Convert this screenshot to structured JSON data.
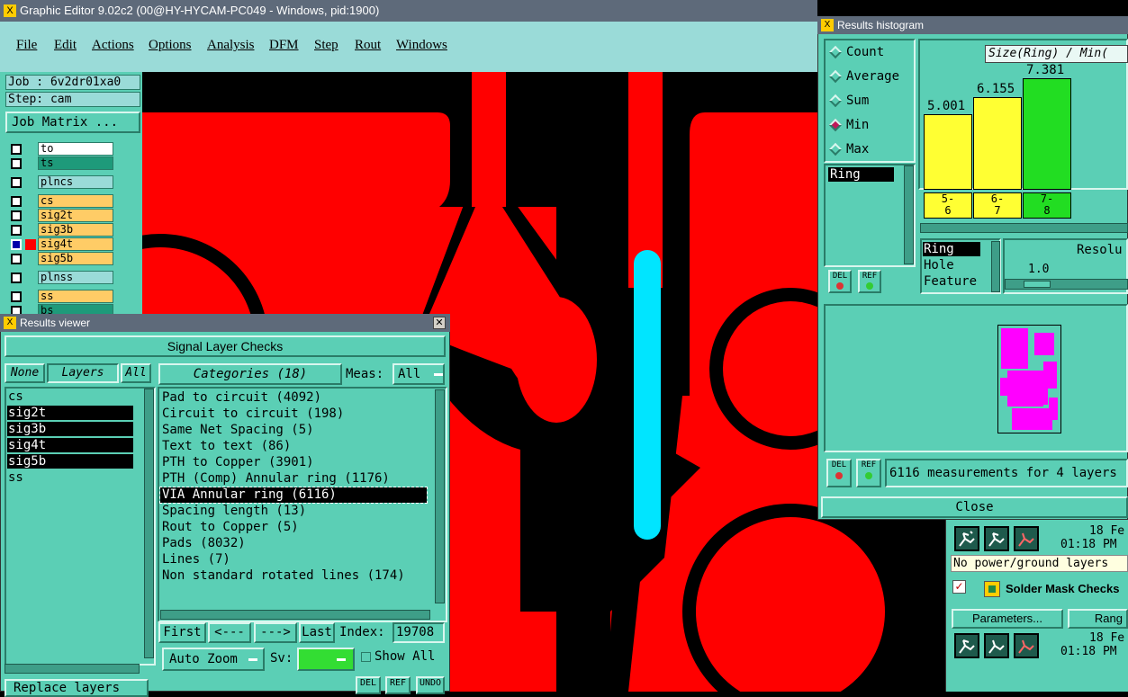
{
  "window": {
    "title": "Graphic Editor 9.02c2 (00@HY-HYCAM-PC049 - Windows, pid:1900)"
  },
  "menu": {
    "items": [
      "File",
      "Edit",
      "Actions",
      "Options",
      "Analysis",
      "DFM",
      "Step",
      "Rout",
      "Windows"
    ]
  },
  "job": {
    "job_label": "Job : 6v2dr01xa0",
    "step_label": "Step: cam",
    "matrix_button": "Job Matrix ..."
  },
  "layers_panel": [
    {
      "name": "to",
      "color": "#ffffff"
    },
    {
      "name": "ts",
      "color": "#1e9a7a"
    },
    {
      "name": "plncs",
      "color": "#9adbd8"
    },
    {
      "name": "cs",
      "color": "#ffcc66"
    },
    {
      "name": "sig2t",
      "color": "#ffcc66"
    },
    {
      "name": "sig3b",
      "color": "#ffcc66"
    },
    {
      "name": "sig4t",
      "color": "#ffcc66"
    },
    {
      "name": "sig5b",
      "color": "#ffcc66"
    },
    {
      "name": "plnss",
      "color": "#9adbd8"
    },
    {
      "name": "ss",
      "color": "#ffcc66"
    },
    {
      "name": "bs",
      "color": "#1e9a7a"
    }
  ],
  "results_viewer": {
    "title": "Results viewer",
    "header": "Signal Layer Checks",
    "none_label": "None",
    "layers_label": "Layers",
    "all_label": "All",
    "categories_label": "Categories (18)",
    "meas_label": "Meas:",
    "meas_value": "All",
    "layers": [
      {
        "name": "cs",
        "sel": false
      },
      {
        "name": "sig2t",
        "sel": true
      },
      {
        "name": "sig3b",
        "sel": true
      },
      {
        "name": "sig4t",
        "sel": true
      },
      {
        "name": "sig5b",
        "sel": true
      },
      {
        "name": "ss",
        "sel": false
      }
    ],
    "categories": [
      {
        "text": "Pad to circuit (4092)",
        "sel": false
      },
      {
        "text": "Circuit to circuit (198)",
        "sel": false
      },
      {
        "text": "Same Net Spacing (5)",
        "sel": false
      },
      {
        "text": "Text to text (86)",
        "sel": false
      },
      {
        "text": "PTH to Copper (3901)",
        "sel": false
      },
      {
        "text": "PTH (Comp) Annular ring (1176)",
        "sel": false
      },
      {
        "text": "VIA Annular ring (6116)",
        "sel": true
      },
      {
        "text": "Spacing length (13)",
        "sel": false
      },
      {
        "text": "Rout to Copper (5)",
        "sel": false
      },
      {
        "text": "Pads (8032)",
        "sel": false
      },
      {
        "text": "Lines (7)",
        "sel": false
      },
      {
        "text": "Non standard rotated lines (174)",
        "sel": false
      }
    ],
    "first": "First",
    "prev": "<---",
    "next": "--->",
    "last": "Last",
    "index_label": "Index:",
    "index_value": "19708",
    "auto_zoom": "Auto Zoom",
    "sv_label": "Sv:",
    "show_all": "Show All",
    "replace_layers": "Replace layers",
    "del": "DEL",
    "ref": "REF",
    "undo": "UNDO"
  },
  "histogram": {
    "title": "Results histogram",
    "modes": [
      {
        "label": "Count",
        "sel": false
      },
      {
        "label": "Average",
        "sel": false
      },
      {
        "label": "Sum",
        "sel": false
      },
      {
        "label": "Min",
        "sel": true
      },
      {
        "label": "Max",
        "sel": false
      }
    ],
    "chart_title": "Size(Ring) / Min(",
    "bars": [
      {
        "value": "5.001",
        "range": "5-\n6",
        "color": "#ffff33"
      },
      {
        "value": "6.155",
        "range": "6-\n7",
        "color": "#ffff33"
      },
      {
        "value": "7.381",
        "range": "7-\n8",
        "color": "#22dd22"
      }
    ],
    "attr_list": [
      "Ring"
    ],
    "types": [
      {
        "label": "Ring",
        "sel": true
      },
      {
        "label": "Hole",
        "sel": false
      },
      {
        "label": "Feature",
        "sel": false
      }
    ],
    "resolution_label": "Resolu",
    "resolution_value": "1.0",
    "del": "DEL",
    "ref": "REF",
    "summary": "6116 measurements for 4 layers",
    "close": "Close"
  },
  "right_panel": {
    "date1": "18 Fe",
    "time1": "01:18 PM",
    "no_power": "No power/ground layers",
    "solder_mask": "Solder Mask Checks",
    "parameters": "Parameters...",
    "range": "Rang",
    "date2": "18 Fe",
    "time2": "01:18 PM"
  }
}
